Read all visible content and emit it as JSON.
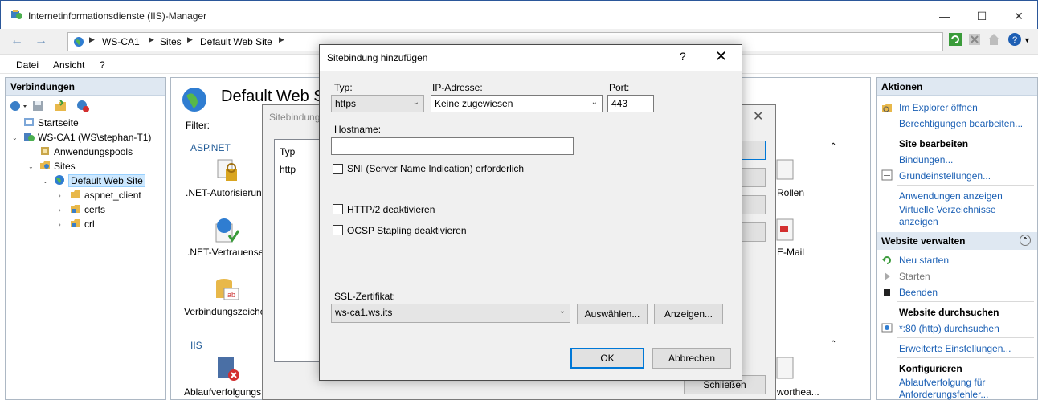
{
  "window": {
    "title": "Internetinformationsdienste (IIS)-Manager"
  },
  "address": {
    "crumbs": [
      "WS-CA1",
      "Sites",
      "Default Web Site"
    ]
  },
  "menu": {
    "items": [
      "Datei",
      "Ansicht",
      "?"
    ]
  },
  "connections": {
    "header": "Verbindungen",
    "tree": {
      "start": "Startseite",
      "server": "WS-CA1 (WS\\stephan-T1)",
      "apppools": "Anwendungspools",
      "sites": "Sites",
      "site": "Default Web Site",
      "children": [
        "aspnet_client",
        "certs",
        "crl"
      ]
    }
  },
  "center": {
    "title": "Default Web Site",
    "filter_label": "Filter:",
    "groups": {
      "aspnet": "ASP.NET",
      "iis": "IIS"
    },
    "features": [
      ".NET-Autorisierun",
      ".NET-Vertrauense",
      "Verbindungszeiche",
      "Ablaufverfolgungs"
    ],
    "right_features": [
      "Rollen",
      "E-Mail",
      "worthea..."
    ]
  },
  "bindings_dialog": {
    "title": "Sitebindung",
    "col_type": "Typ",
    "row_type": "http",
    "close_label": "Schließen"
  },
  "add_binding": {
    "title": "Sitebindung hinzufügen",
    "help": "?",
    "type_label": "Typ:",
    "type_value": "https",
    "ip_label": "IP-Adresse:",
    "ip_value": "Keine zugewiesen",
    "port_label": "Port:",
    "port_value": "443",
    "hostname_label": "Hostname:",
    "hostname_value": "",
    "sni_label": "SNI (Server Name Indication) erforderlich",
    "http2_label": "HTTP/2 deaktivieren",
    "ocsp_label": "OCSP Stapling deaktivieren",
    "ssl_label": "SSL-Zertifikat:",
    "ssl_value": "ws-ca1.ws.its",
    "select_btn": "Auswählen...",
    "view_btn": "Anzeigen...",
    "ok_btn": "OK",
    "cancel_btn": "Abbrechen"
  },
  "actions": {
    "header": "Aktionen",
    "explore": "Im Explorer öffnen",
    "permissions": "Berechtigungen bearbeiten...",
    "edit_site": "Site bearbeiten",
    "bindings": "Bindungen...",
    "basic_settings": "Grundeinstellungen...",
    "view_apps": "Anwendungen anzeigen",
    "view_vdirs_1": "Virtuelle Verzeichnisse",
    "view_vdirs_2": "anzeigen",
    "manage_site": "Website verwalten",
    "restart": "Neu starten",
    "start": "Starten",
    "stop": "Beenden",
    "browse_site": "Website durchsuchen",
    "browse_80": "*:80 (http) durchsuchen",
    "advanced": "Erweiterte Einstellungen...",
    "configure": "Konfigurieren",
    "tracing_1": "Ablaufverfolgung für",
    "tracing_2": "Anforderungsfehler..."
  }
}
